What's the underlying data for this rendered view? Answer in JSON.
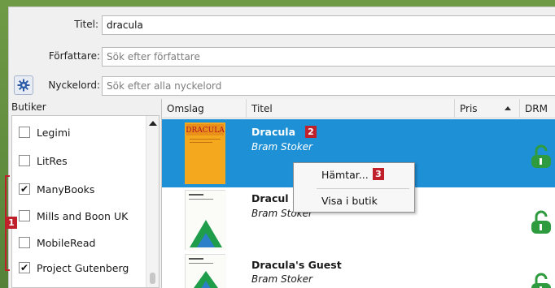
{
  "search": {
    "title_label": "Titel:",
    "title_value": "dracula",
    "author_label": "Författare:",
    "author_placeholder": "Sök efter författare",
    "keywords_label": "Nyckelord:",
    "keywords_placeholder": "Sök efter alla nyckelord"
  },
  "stores": {
    "header": "Butiker",
    "items": [
      {
        "label": "Legimi",
        "checked": false
      },
      {
        "label": "LitRes",
        "checked": false
      },
      {
        "label": "ManyBooks",
        "checked": true
      },
      {
        "label": "Mills and Boon UK",
        "checked": false
      },
      {
        "label": "MobileRead",
        "checked": false
      },
      {
        "label": "Project Gutenberg",
        "checked": true
      }
    ],
    "badge": "1"
  },
  "results": {
    "columns": [
      "Omslag",
      "Titel",
      "Pris",
      "DRM"
    ],
    "rows": [
      {
        "title": "Dracula",
        "author": "Bram Stoker",
        "selected": true,
        "badge": "2"
      },
      {
        "title": "Dracul",
        "author": "Bram Stoker",
        "selected": false
      },
      {
        "title": "Dracula's Guest",
        "author": "Bram Stoker",
        "selected": false
      }
    ]
  },
  "context_menu": {
    "items": [
      "Hämtar...",
      "Visa i butik"
    ],
    "badge": "3"
  },
  "colors": {
    "selection": "#1e90d6",
    "annotation": "#c0202a",
    "drm_icon": "#2e9b3e"
  },
  "icons": {
    "settings": "gear-icon",
    "drm": "unlocked-drm-icon",
    "sort": "sort-ascending-icon"
  }
}
